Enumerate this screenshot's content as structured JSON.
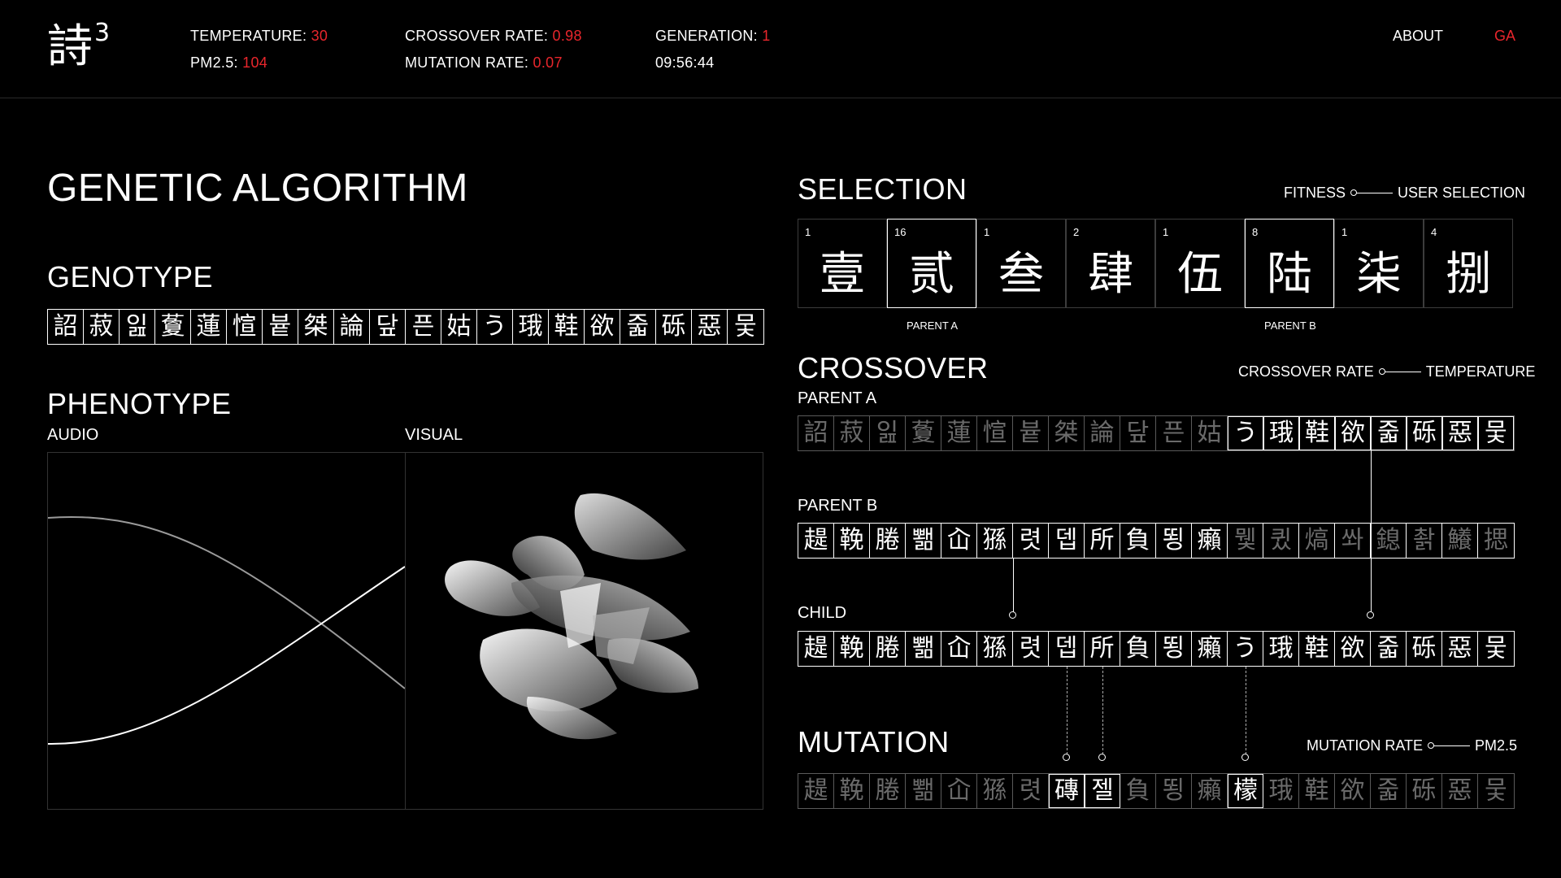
{
  "header": {
    "logo": "詩",
    "logo_sup": "3",
    "temperature_label": "TEMPERATURE:",
    "temperature_value": "30",
    "pm25_label": "PM2.5:",
    "pm25_value": "104",
    "crossover_label": "CROSSOVER RATE:",
    "crossover_value": "0.98",
    "mutation_label": "MUTATION RATE:",
    "mutation_value": "0.07",
    "generation_label": "GENERATION:",
    "generation_value": "1",
    "time": "09:56:44",
    "nav": {
      "about": "ABOUT",
      "ga": "GA"
    }
  },
  "left": {
    "title": "GENETIC ALGORITHM",
    "genotype_title": "GENOTYPE",
    "genotype": [
      "詔",
      "菽",
      "잂",
      "藑",
      "蓮",
      "愃",
      "븉",
      "桀",
      "論",
      "닾",
      "픈",
      "姑",
      "う",
      "珴",
      "鞋",
      "欲",
      "줇",
      "砾",
      "惡",
      "뭋"
    ],
    "phenotype_title": "PHENOTYPE",
    "audio_label": "AUDIO",
    "visual_label": "VISUAL"
  },
  "selection": {
    "title": "SELECTION",
    "legend_left": "FITNESS",
    "legend_right": "USER SELECTION",
    "cards": [
      {
        "fitness": "1",
        "char": "壹"
      },
      {
        "fitness": "16",
        "char": "贰"
      },
      {
        "fitness": "1",
        "char": "叁"
      },
      {
        "fitness": "2",
        "char": "肆"
      },
      {
        "fitness": "1",
        "char": "伍"
      },
      {
        "fitness": "8",
        "char": "陆"
      },
      {
        "fitness": "1",
        "char": "柒"
      },
      {
        "fitness": "4",
        "char": "捌"
      }
    ],
    "parent_a_label": "PARENT A",
    "parent_b_label": "PARENT B"
  },
  "crossover": {
    "title": "CROSSOVER",
    "legend_left": "CROSSOVER RATE",
    "legend_right": "TEMPERATURE",
    "parent_a_label": "PARENT A",
    "parent_b_label": "PARENT B",
    "child_label": "CHILD",
    "parent_a": [
      "詔",
      "菽",
      "잂",
      "藑",
      "蓮",
      "愃",
      "븉",
      "桀",
      "論",
      "닾",
      "픈",
      "姑",
      "う",
      "珴",
      "鞋",
      "欲",
      "줇",
      "砾",
      "惡",
      "뭋"
    ],
    "parent_b": [
      "趧",
      "鞔",
      "腃",
      "뾂",
      "屳",
      "猻",
      "렷",
      "뎁",
      "所",
      "負",
      "뙹",
      "癩",
      "뮃",
      "큈",
      "熇",
      "쏴",
      "鎴",
      "촭",
      "鱶",
      "揌"
    ],
    "child": [
      "趧",
      "鞔",
      "腃",
      "뾂",
      "屳",
      "猻",
      "렷",
      "뎁",
      "所",
      "負",
      "뙹",
      "癩",
      "う",
      "珴",
      "鞋",
      "欲",
      "줇",
      "砾",
      "惡",
      "뭋"
    ]
  },
  "mutation": {
    "title": "MUTATION",
    "legend_left": "MUTATION RATE",
    "legend_right": "PM2.5",
    "result": [
      "趧",
      "鞔",
      "腃",
      "뾂",
      "屳",
      "猻",
      "렷",
      "磚",
      "젤",
      "負",
      "뙹",
      "癩",
      "檬",
      "珴",
      "鞋",
      "欲",
      "줇",
      "砾",
      "惡",
      "뭋"
    ]
  }
}
